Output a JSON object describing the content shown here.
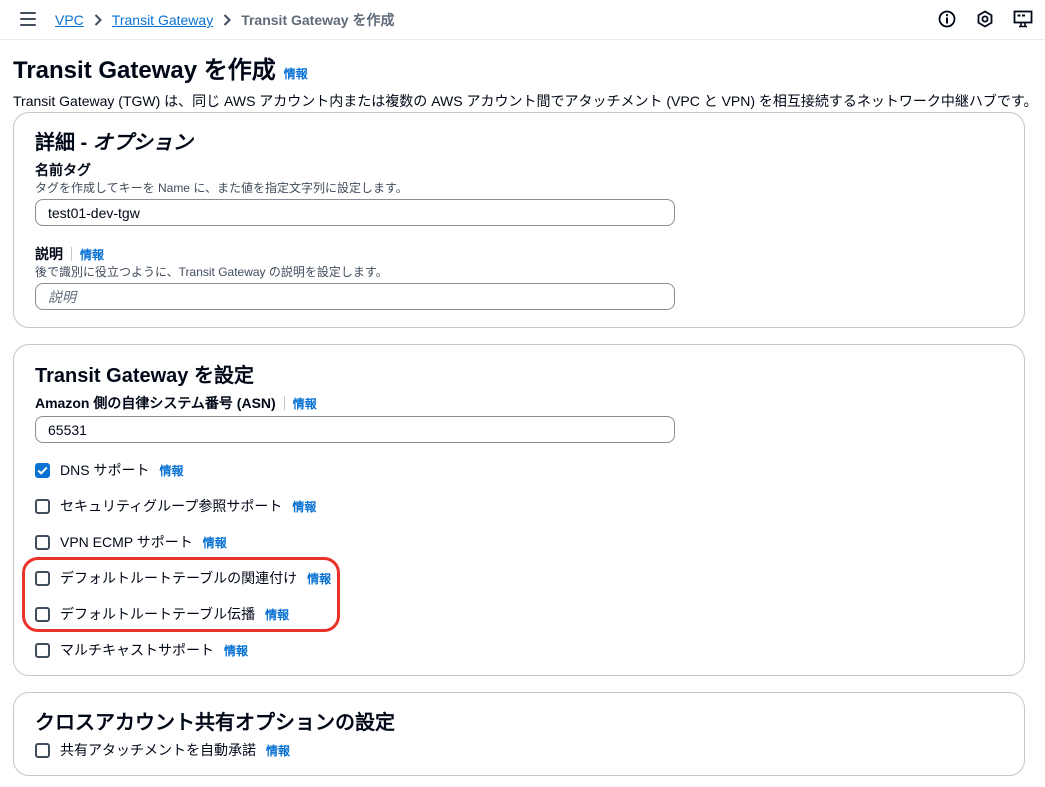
{
  "breadcrumb": {
    "items": [
      "VPC",
      "Transit Gateway"
    ],
    "current": "Transit Gateway を作成"
  },
  "header": {
    "title": "Transit Gateway を作成",
    "info": "情報",
    "description": "Transit Gateway (TGW) は、同じ AWS アカウント内または複数の AWS アカウント間でアタッチメント (VPC と VPN) を相互接続するネットワーク中継ハブです。"
  },
  "details": {
    "title_main": "詳細 - ",
    "title_em": "オプション",
    "name_tag_label": "名前タグ",
    "name_tag_desc": "タグを作成してキーを Name に、また値を指定文字列に設定します。",
    "name_tag_value": "test01-dev-tgw",
    "description_label": "説明",
    "description_info": "情報",
    "description_desc": "後で識別に役立つように、Transit Gateway の説明を設定します。",
    "description_placeholder": "説明"
  },
  "configure": {
    "title": "Transit Gateway を設定",
    "asn_label": "Amazon 側の自律システム番号 (ASN)",
    "asn_info": "情報",
    "asn_value": "65531",
    "options": [
      {
        "label": "DNS サポート",
        "info": "情報",
        "checked": true
      },
      {
        "label": "セキュリティグループ参照サポート",
        "info": "情報",
        "checked": false
      },
      {
        "label": "VPN ECMP サポート",
        "info": "情報",
        "checked": false
      },
      {
        "label": "デフォルトルートテーブルの関連付け",
        "info": "情報",
        "checked": false
      },
      {
        "label": "デフォルトルートテーブル伝播",
        "info": "情報",
        "checked": false
      },
      {
        "label": "マルチキャストサポート",
        "info": "情報",
        "checked": false
      }
    ]
  },
  "cross_account": {
    "title": "クロスアカウント共有オプションの設定",
    "option": {
      "label": "共有アタッチメントを自動承諾",
      "info": "情報",
      "checked": false
    }
  },
  "colors": {
    "link": "#0972d3",
    "checked": "#0972d3",
    "highlight": "#e8322a"
  },
  "icons": [
    "menu-icon",
    "chevron-right-icon",
    "info-circle-icon",
    "gear-hex-icon",
    "display-settings-icon",
    "checkmark-icon"
  ]
}
